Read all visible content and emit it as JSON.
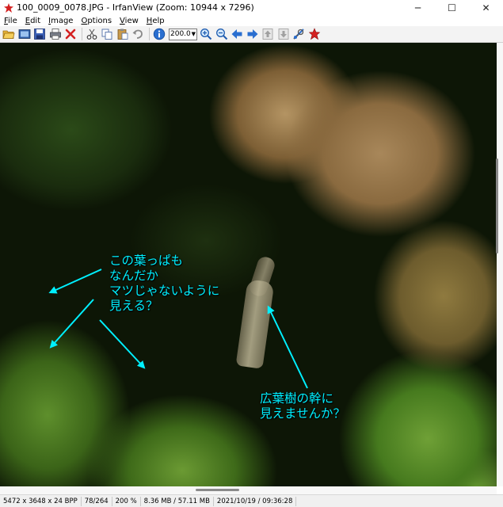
{
  "window": {
    "title": "100_0009_0078.JPG - IrfanView (Zoom: 10944 x 7296)",
    "controls": {
      "minimize": "─",
      "maximize": "☐",
      "close": "✕"
    }
  },
  "menu": {
    "items": [
      {
        "u": "F",
        "rest": "ile"
      },
      {
        "u": "E",
        "rest": "dit"
      },
      {
        "u": "I",
        "rest": "mage"
      },
      {
        "u": "O",
        "rest": "ptions"
      },
      {
        "u": "V",
        "rest": "iew"
      },
      {
        "u": "H",
        "rest": "elp"
      }
    ]
  },
  "toolbar": {
    "zoom_value": "200.0",
    "icons": [
      "open-folder-icon",
      "slideshow-icon",
      "save-icon",
      "print-icon",
      "delete-icon",
      "cut-icon",
      "copy-icon",
      "paste-icon",
      "undo-icon",
      "info-icon",
      "zoom-in-icon",
      "zoom-out-icon",
      "prev-arrow-icon",
      "next-arrow-icon",
      "page-up-icon",
      "page-down-icon",
      "settings-icon",
      "exit-icon"
    ]
  },
  "annotations": {
    "left_text": [
      "この葉っぱも",
      "なんだか",
      "マツじゃないように",
      "見える？"
    ],
    "right_text": [
      "広葉樹の幹に",
      "見えませんか？"
    ],
    "color": "#00f0ff"
  },
  "statusbar": {
    "dimensions": "5472 x 3648 x 24 BPP",
    "index": "78/264",
    "zoom": "200 %",
    "memory": "8.36 MB / 57.11 MB",
    "datetime": "2021/10/19 / 09:36:28"
  }
}
